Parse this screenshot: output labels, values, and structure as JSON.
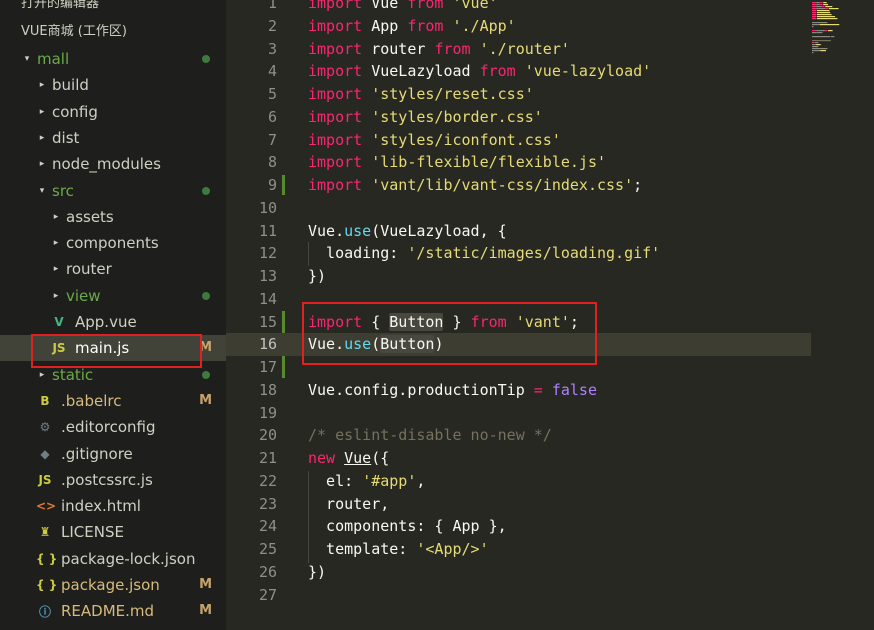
{
  "sidebar": {
    "open_editors": "打开的编辑器",
    "workspace": "VUE商城 (工作区)",
    "tree": [
      {
        "label": "mall",
        "depth": 0,
        "chev": "▾",
        "status": "dot",
        "kind": "folder-green"
      },
      {
        "label": "build",
        "depth": 1,
        "chev": "▸",
        "status": "",
        "kind": "folder"
      },
      {
        "label": "config",
        "depth": 1,
        "chev": "▸",
        "status": "",
        "kind": "folder"
      },
      {
        "label": "dist",
        "depth": 1,
        "chev": "▸",
        "status": "",
        "kind": "folder"
      },
      {
        "label": "node_modules",
        "depth": 1,
        "chev": "▸",
        "status": "",
        "kind": "folder"
      },
      {
        "label": "src",
        "depth": 1,
        "chev": "▾",
        "status": "dot",
        "kind": "folder-green"
      },
      {
        "label": "assets",
        "depth": 2,
        "chev": "▸",
        "status": "",
        "kind": "folder"
      },
      {
        "label": "components",
        "depth": 2,
        "chev": "▸",
        "status": "",
        "kind": "folder"
      },
      {
        "label": "router",
        "depth": 2,
        "chev": "▸",
        "status": "",
        "kind": "folder"
      },
      {
        "label": "view",
        "depth": 2,
        "chev": "▸",
        "status": "dot",
        "kind": "folder-green"
      },
      {
        "label": "App.vue",
        "depth": 2,
        "chev": "",
        "status": "",
        "kind": "vue"
      },
      {
        "label": "main.js",
        "depth": 2,
        "chev": "",
        "status": "M",
        "kind": "js",
        "selected": true
      },
      {
        "label": "static",
        "depth": 1,
        "chev": "▸",
        "status": "dot",
        "kind": "folder-green"
      },
      {
        "label": ".babelrc",
        "depth": 1,
        "chev": "",
        "status": "M",
        "kind": "babel"
      },
      {
        "label": ".editorconfig",
        "depth": 1,
        "chev": "",
        "status": "",
        "kind": "gear"
      },
      {
        "label": ".gitignore",
        "depth": 1,
        "chev": "",
        "status": "",
        "kind": "git"
      },
      {
        "label": ".postcssrc.js",
        "depth": 1,
        "chev": "",
        "status": "",
        "kind": "js"
      },
      {
        "label": "index.html",
        "depth": 1,
        "chev": "",
        "status": "",
        "kind": "html"
      },
      {
        "label": "LICENSE",
        "depth": 1,
        "chev": "",
        "status": "",
        "kind": "license"
      },
      {
        "label": "package-lock.json",
        "depth": 1,
        "chev": "",
        "status": "",
        "kind": "json"
      },
      {
        "label": "package.json",
        "depth": 1,
        "chev": "",
        "status": "M",
        "kind": "json"
      },
      {
        "label": "README.md",
        "depth": 1,
        "chev": "",
        "status": "M",
        "kind": "info"
      }
    ]
  },
  "icons": {
    "vue": "V",
    "js": "JS",
    "json": "{ }",
    "html": "<>",
    "gear": "⚙",
    "git": "◆",
    "babel": "B",
    "license": "♜",
    "info": "ⓘ"
  },
  "colors": {
    "keyword": "#f92672",
    "string": "#e6db74",
    "function": "#66d9ef",
    "comment": "#75715e",
    "constant": "#ae81ff",
    "annotation": "#e22020"
  },
  "editor": {
    "current_line": 16,
    "lines": [
      [
        [
          "kw",
          "import"
        ],
        [
          "t",
          " Vue "
        ],
        [
          "kw",
          "from"
        ],
        [
          "t",
          " "
        ],
        [
          "str",
          "'vue'"
        ]
      ],
      [
        [
          "kw",
          "import"
        ],
        [
          "t",
          " App "
        ],
        [
          "kw",
          "from"
        ],
        [
          "t",
          " "
        ],
        [
          "str",
          "'./App'"
        ]
      ],
      [
        [
          "kw",
          "import"
        ],
        [
          "t",
          " router "
        ],
        [
          "kw",
          "from"
        ],
        [
          "t",
          " "
        ],
        [
          "str",
          "'./router'"
        ]
      ],
      [
        [
          "kw",
          "import"
        ],
        [
          "t",
          " VueLazyload "
        ],
        [
          "kw",
          "from"
        ],
        [
          "t",
          " "
        ],
        [
          "str",
          "'vue-lazyload'"
        ]
      ],
      [
        [
          "kw",
          "import"
        ],
        [
          "t",
          " "
        ],
        [
          "str",
          "'styles/reset.css'"
        ]
      ],
      [
        [
          "kw",
          "import"
        ],
        [
          "t",
          " "
        ],
        [
          "str",
          "'styles/border.css'"
        ]
      ],
      [
        [
          "kw",
          "import"
        ],
        [
          "t",
          " "
        ],
        [
          "str",
          "'styles/iconfont.css'"
        ]
      ],
      [
        [
          "kw",
          "import"
        ],
        [
          "t",
          " "
        ],
        [
          "str",
          "'lib-flexible/flexible.js'"
        ]
      ],
      [
        [
          "kw",
          "import"
        ],
        [
          "t",
          " "
        ],
        [
          "str",
          "'vant/lib/vant-css/index.css'"
        ],
        [
          "t",
          ";"
        ]
      ],
      [],
      [
        [
          "t",
          "Vue."
        ],
        [
          "fn",
          "use"
        ],
        [
          "t",
          "(VueLazyload, {"
        ]
      ],
      [
        [
          "t",
          "  loading: "
        ],
        [
          "str",
          "'/static/images/loading.gif'"
        ]
      ],
      [
        [
          "t",
          "})"
        ]
      ],
      [],
      [
        [
          "kw",
          "import"
        ],
        [
          "t",
          " { "
        ],
        [
          "hl",
          "Button"
        ],
        [
          "t",
          " } "
        ],
        [
          "kw",
          "from"
        ],
        [
          "t",
          " "
        ],
        [
          "str",
          "'vant'"
        ],
        [
          "t",
          ";"
        ]
      ],
      [
        [
          "t",
          "Vue."
        ],
        [
          "fn",
          "use"
        ],
        [
          "t",
          "("
        ],
        [
          "hl",
          "Button"
        ],
        [
          "t",
          ")"
        ]
      ],
      [],
      [
        [
          "t",
          "Vue.config.productionTip "
        ],
        [
          "op",
          "="
        ],
        [
          "t",
          " "
        ],
        [
          "const",
          "false"
        ]
      ],
      [],
      [
        [
          "cm",
          "/* eslint-disable no-new */"
        ]
      ],
      [
        [
          "kw",
          "new"
        ],
        [
          "t",
          " "
        ],
        [
          "ul",
          "Vue"
        ],
        [
          "t",
          "({"
        ]
      ],
      [
        [
          "t",
          "  el: "
        ],
        [
          "str",
          "'#app'"
        ],
        [
          "t",
          ","
        ]
      ],
      [
        [
          "t",
          "  router,"
        ]
      ],
      [
        [
          "t",
          "  components: { App },"
        ]
      ],
      [
        [
          "t",
          "  template: "
        ],
        [
          "str",
          "'<App/>'"
        ]
      ],
      [
        [
          "t",
          "})"
        ]
      ],
      []
    ]
  }
}
